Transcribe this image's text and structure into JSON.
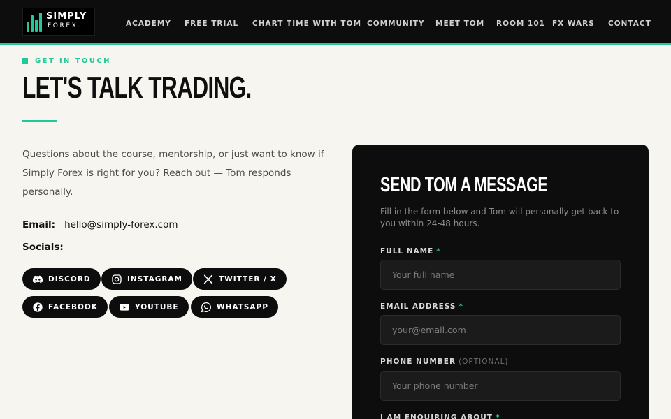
{
  "header": {
    "logo": {
      "line1": "SIMPLY",
      "line2": "FOREX."
    },
    "nav": [
      {
        "id": "academy",
        "label": "ACADEMY"
      },
      {
        "id": "free-trial",
        "label": "FREE TRIAL"
      },
      {
        "id": "chart-time",
        "label": "CHART TIME WITH TOM"
      },
      {
        "id": "community",
        "label": "COMMUNITY"
      },
      {
        "id": "meet-tom",
        "label": "MEET TOM"
      },
      {
        "id": "room-101",
        "label": "ROOM 101"
      },
      {
        "id": "fx-wars",
        "label": "FX WARS"
      },
      {
        "id": "contact",
        "label": "CONTACT"
      }
    ]
  },
  "hero": {
    "eyebrow": "GET IN TOUCH",
    "title": "LET'S TALK TRADING."
  },
  "contact": {
    "intro": "Questions about the course, mentorship, or just want to know if Simply Forex is right for you? Reach out — Tom responds personally.",
    "email_label": "Email:",
    "email_value": "hello@simply-forex.com",
    "socials_label": "Socials:",
    "socials": [
      {
        "id": "discord",
        "label": "DISCORD",
        "icon": "discord-icon"
      },
      {
        "id": "instagram",
        "label": "INSTAGRAM",
        "icon": "instagram-icon"
      },
      {
        "id": "twitter",
        "label": "TWITTER / X",
        "icon": "x-icon"
      },
      {
        "id": "facebook",
        "label": "FACEBOOK",
        "icon": "facebook-icon"
      },
      {
        "id": "youtube",
        "label": "YOUTUBE",
        "icon": "youtube-icon"
      },
      {
        "id": "whatsapp",
        "label": "WHATSAPP",
        "icon": "whatsapp-icon"
      }
    ]
  },
  "form": {
    "title": "SEND TOM A MESSAGE",
    "subtitle": "Fill in the form below and Tom will personally get back to you within 24-48 hours.",
    "required_mark": "*",
    "fields": {
      "name": {
        "label": "FULL NAME",
        "placeholder": "Your full name"
      },
      "email": {
        "label": "EMAIL ADDRESS",
        "placeholder": "your@email.com"
      },
      "phone": {
        "label": "PHONE NUMBER",
        "optional": "(OPTIONAL)",
        "placeholder": "Your phone number"
      },
      "enquiry": {
        "label": "I AM ENQUIRING ABOUT"
      }
    }
  },
  "colors": {
    "accent": "#22c79a",
    "dark": "#0d0d0d",
    "background": "#f6f5ef"
  }
}
